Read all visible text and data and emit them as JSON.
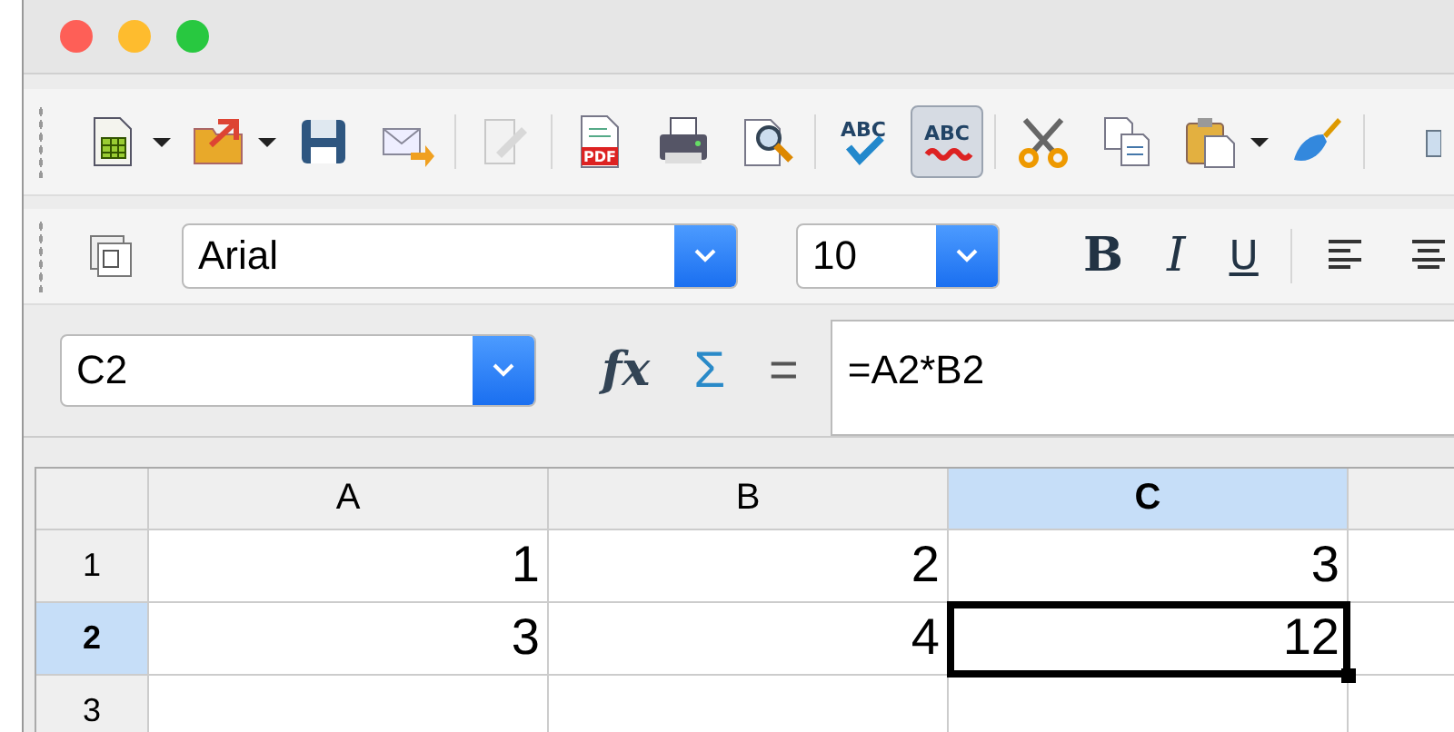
{
  "window": {
    "controls": [
      {
        "kind": "close"
      },
      {
        "kind": "minimize"
      },
      {
        "kind": "zoom"
      }
    ]
  },
  "standard_toolbar": [
    {
      "kind": "new",
      "dropdown": true
    },
    {
      "kind": "open",
      "dropdown": true
    },
    {
      "kind": "save"
    },
    {
      "kind": "email"
    },
    {
      "kind": "separator"
    },
    {
      "kind": "edit",
      "disabled": true
    },
    {
      "kind": "separator"
    },
    {
      "kind": "pdf",
      "text": "PDF"
    },
    {
      "kind": "print"
    },
    {
      "kind": "preview"
    },
    {
      "kind": "separator"
    },
    {
      "kind": "spellcheck",
      "text": "ABC"
    },
    {
      "kind": "autospell",
      "text": "ABC",
      "pressed": true
    },
    {
      "kind": "separator"
    },
    {
      "kind": "cut"
    },
    {
      "kind": "copy"
    },
    {
      "kind": "paste",
      "dropdown": true
    },
    {
      "kind": "brush"
    },
    {
      "kind": "separator"
    },
    {
      "kind": "partial"
    }
  ],
  "format_toolbar": {
    "font_name": "Arial",
    "font_size": "10",
    "buttons": [
      {
        "kind": "bold",
        "text": "B"
      },
      {
        "kind": "italic",
        "text": "I"
      },
      {
        "kind": "underline",
        "text": "U"
      },
      {
        "kind": "separator"
      },
      {
        "kind": "align-left"
      },
      {
        "kind": "align-center"
      }
    ]
  },
  "formula_bar": {
    "name_box": "C2",
    "buttons": [
      {
        "kind": "function",
        "text": "fx"
      },
      {
        "kind": "sum",
        "text": "Σ"
      },
      {
        "kind": "equals",
        "text": "="
      }
    ],
    "formula": "=A2*B2"
  },
  "sheet": {
    "columns": [
      {
        "label": "A",
        "selected": false
      },
      {
        "label": "B",
        "selected": false
      },
      {
        "label": "C",
        "selected": true
      },
      {
        "selected": false
      }
    ],
    "rows": [
      {
        "label": "1",
        "selected": false,
        "cells": [
          {
            "value": "1",
            "selected": false
          },
          {
            "value": "2",
            "selected": false
          },
          {
            "value": "3",
            "selected": false
          }
        ]
      },
      {
        "label": "2",
        "selected": true,
        "cells": [
          {
            "value": "3",
            "selected": false
          },
          {
            "value": "4",
            "selected": false
          },
          {
            "value": "12",
            "selected": true
          }
        ]
      },
      {
        "label": "3",
        "selected": false,
        "cells": [
          {
            "selected": false
          },
          {
            "selected": false
          },
          {
            "selected": false
          }
        ]
      }
    ]
  }
}
